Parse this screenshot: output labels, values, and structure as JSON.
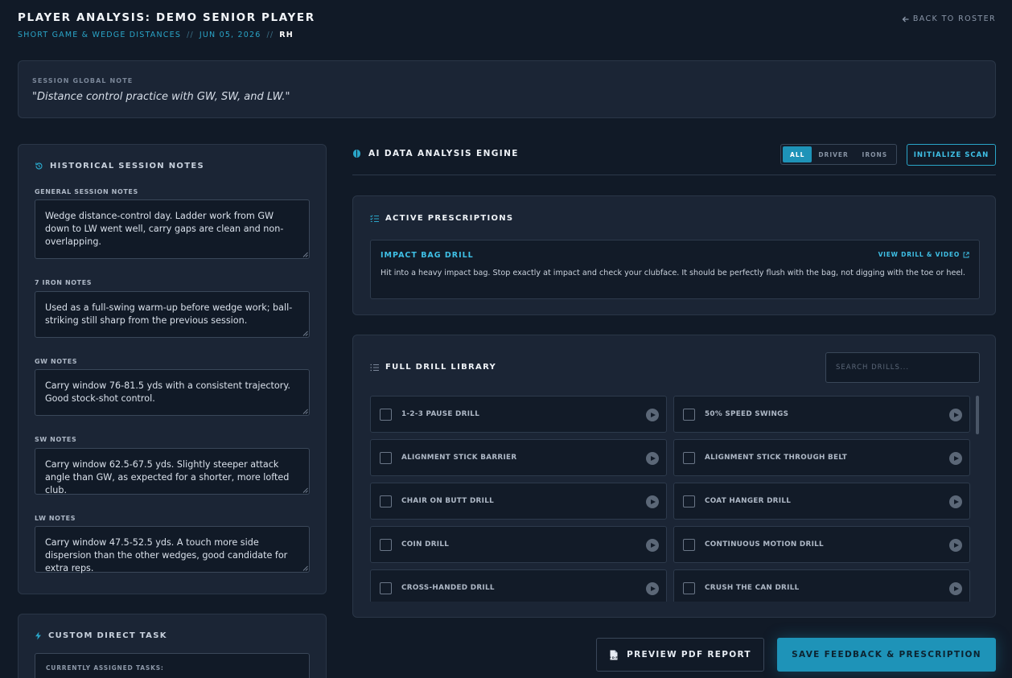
{
  "header": {
    "title": "PLAYER ANALYSIS: DEMO SENIOR PLAYER",
    "session_type": "SHORT GAME & WEDGE DISTANCES",
    "separator": "//",
    "date": "JUN 05, 2026",
    "handedness": "RH",
    "back_label": "BACK TO ROSTER"
  },
  "global_note": {
    "label": "SESSION GLOBAL NOTE",
    "text": "\"Distance control practice with GW, SW, and LW.\""
  },
  "history": {
    "title": "HISTORICAL SESSION NOTES",
    "fields": [
      {
        "label": "GENERAL SESSION NOTES",
        "text": "Wedge distance-control day. Ladder work from GW down to LW went well, carry gaps are clean and non-overlapping."
      },
      {
        "label": "7 IRON NOTES",
        "text": "Used as a full-swing warm-up before wedge work; ball-striking still sharp from the previous session."
      },
      {
        "label": "GW NOTES",
        "text": "Carry window 76-81.5 yds with a consistent trajectory. Good stock-shot control."
      },
      {
        "label": "SW NOTES",
        "text": "Carry window 62.5-67.5 yds. Slightly steeper attack angle than GW, as expected for a shorter, more lofted club."
      },
      {
        "label": "LW NOTES",
        "text": "Carry window 47.5-52.5 yds. A touch more side dispersion than the other wedges, good candidate for extra reps."
      }
    ]
  },
  "custom_task": {
    "title": "CUSTOM DIRECT TASK",
    "assigned_label": "CURRENTLY ASSIGNED TASKS:"
  },
  "engine": {
    "title": "AI DATA ANALYSIS ENGINE",
    "filters": [
      "ALL",
      "DRIVER",
      "IRONS"
    ],
    "active_filter": "ALL",
    "scan_label": "INITIALIZE SCAN"
  },
  "prescriptions": {
    "title": "ACTIVE PRESCRIPTIONS",
    "items": [
      {
        "name": "IMPACT BAG DRILL",
        "link_label": "VIEW DRILL & VIDEO",
        "description": "Hit into a heavy impact bag. Stop exactly at impact and check your clubface. It should be perfectly flush with the bag, not digging with the toe or heel."
      }
    ]
  },
  "library": {
    "title": "FULL DRILL LIBRARY",
    "search_placeholder": "SEARCH DRILLS...",
    "drills": [
      "1-2-3 PAUSE DRILL",
      "50% SPEED SWINGS",
      "ALIGNMENT STICK BARRIER",
      "ALIGNMENT STICK THROUGH BELT",
      "CHAIR ON BUTT DRILL",
      "COAT HANGER DRILL",
      "COIN DRILL",
      "CONTINUOUS MOTION DRILL",
      "CROSS-HANDED DRILL",
      "CRUSH THE CAN DRILL"
    ]
  },
  "actions": {
    "preview_label": "PREVIEW PDF REPORT",
    "pdf_icon_text": "PDF",
    "save_label": "SAVE FEEDBACK & PRESCRIPTION"
  },
  "colors": {
    "background": "#111a27",
    "panel": "#1b2535",
    "accent": "#1e93b8",
    "accent_text": "#3fc0e6"
  }
}
